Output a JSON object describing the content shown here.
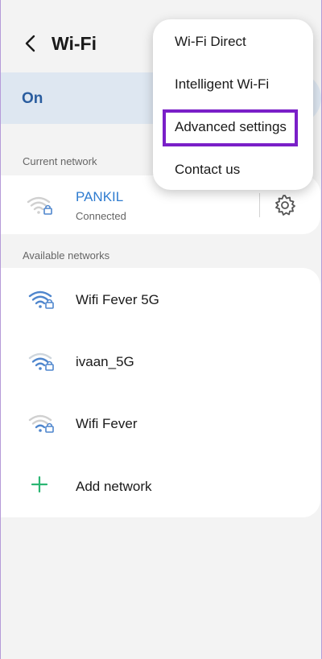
{
  "header": {
    "title": "Wi-Fi",
    "back_icon": "chevron-left-icon"
  },
  "toggle": {
    "label": "On",
    "state": true,
    "accent_color": "#2a5d9f"
  },
  "current_network": {
    "section_label": "Current network",
    "name": "PANKIL",
    "status": "Connected",
    "name_color": "#2f7cd0",
    "settings_icon": "gear-icon"
  },
  "available_networks": {
    "section_label": "Available networks",
    "items": [
      {
        "name": "Wifi Fever 5G",
        "icon": "wifi-lock-icon",
        "signal": "strong"
      },
      {
        "name": "ivaan_5G",
        "icon": "wifi-lock-icon",
        "signal": "medium"
      },
      {
        "name": "Wifi Fever",
        "icon": "wifi-lock-icon",
        "signal": "weak"
      }
    ],
    "add_network": {
      "label": "Add network",
      "icon": "plus-icon",
      "color": "#2bb673"
    }
  },
  "menu": {
    "items": [
      {
        "label": "Wi-Fi Direct"
      },
      {
        "label": "Intelligent Wi-Fi"
      },
      {
        "label": "Advanced settings",
        "highlighted": true
      },
      {
        "label": "Contact us"
      }
    ],
    "highlight_color": "#7a1fc8"
  }
}
